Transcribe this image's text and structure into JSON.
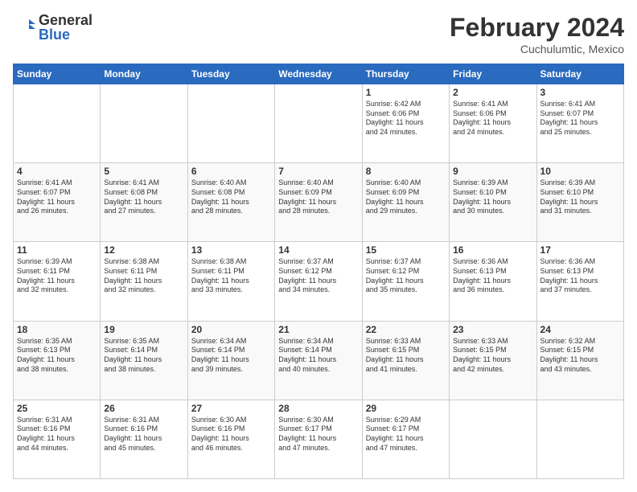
{
  "header": {
    "logo_general": "General",
    "logo_blue": "Blue",
    "cal_title": "February 2024",
    "cal_subtitle": "Cuchulumtic, Mexico"
  },
  "days_of_week": [
    "Sunday",
    "Monday",
    "Tuesday",
    "Wednesday",
    "Thursday",
    "Friday",
    "Saturday"
  ],
  "weeks": [
    [
      {
        "num": "",
        "info": ""
      },
      {
        "num": "",
        "info": ""
      },
      {
        "num": "",
        "info": ""
      },
      {
        "num": "",
        "info": ""
      },
      {
        "num": "1",
        "info": "Sunrise: 6:42 AM\nSunset: 6:06 PM\nDaylight: 11 hours\nand 24 minutes."
      },
      {
        "num": "2",
        "info": "Sunrise: 6:41 AM\nSunset: 6:06 PM\nDaylight: 11 hours\nand 24 minutes."
      },
      {
        "num": "3",
        "info": "Sunrise: 6:41 AM\nSunset: 6:07 PM\nDaylight: 11 hours\nand 25 minutes."
      }
    ],
    [
      {
        "num": "4",
        "info": "Sunrise: 6:41 AM\nSunset: 6:07 PM\nDaylight: 11 hours\nand 26 minutes."
      },
      {
        "num": "5",
        "info": "Sunrise: 6:41 AM\nSunset: 6:08 PM\nDaylight: 11 hours\nand 27 minutes."
      },
      {
        "num": "6",
        "info": "Sunrise: 6:40 AM\nSunset: 6:08 PM\nDaylight: 11 hours\nand 28 minutes."
      },
      {
        "num": "7",
        "info": "Sunrise: 6:40 AM\nSunset: 6:09 PM\nDaylight: 11 hours\nand 28 minutes."
      },
      {
        "num": "8",
        "info": "Sunrise: 6:40 AM\nSunset: 6:09 PM\nDaylight: 11 hours\nand 29 minutes."
      },
      {
        "num": "9",
        "info": "Sunrise: 6:39 AM\nSunset: 6:10 PM\nDaylight: 11 hours\nand 30 minutes."
      },
      {
        "num": "10",
        "info": "Sunrise: 6:39 AM\nSunset: 6:10 PM\nDaylight: 11 hours\nand 31 minutes."
      }
    ],
    [
      {
        "num": "11",
        "info": "Sunrise: 6:39 AM\nSunset: 6:11 PM\nDaylight: 11 hours\nand 32 minutes."
      },
      {
        "num": "12",
        "info": "Sunrise: 6:38 AM\nSunset: 6:11 PM\nDaylight: 11 hours\nand 32 minutes."
      },
      {
        "num": "13",
        "info": "Sunrise: 6:38 AM\nSunset: 6:11 PM\nDaylight: 11 hours\nand 33 minutes."
      },
      {
        "num": "14",
        "info": "Sunrise: 6:37 AM\nSunset: 6:12 PM\nDaylight: 11 hours\nand 34 minutes."
      },
      {
        "num": "15",
        "info": "Sunrise: 6:37 AM\nSunset: 6:12 PM\nDaylight: 11 hours\nand 35 minutes."
      },
      {
        "num": "16",
        "info": "Sunrise: 6:36 AM\nSunset: 6:13 PM\nDaylight: 11 hours\nand 36 minutes."
      },
      {
        "num": "17",
        "info": "Sunrise: 6:36 AM\nSunset: 6:13 PM\nDaylight: 11 hours\nand 37 minutes."
      }
    ],
    [
      {
        "num": "18",
        "info": "Sunrise: 6:35 AM\nSunset: 6:13 PM\nDaylight: 11 hours\nand 38 minutes."
      },
      {
        "num": "19",
        "info": "Sunrise: 6:35 AM\nSunset: 6:14 PM\nDaylight: 11 hours\nand 38 minutes."
      },
      {
        "num": "20",
        "info": "Sunrise: 6:34 AM\nSunset: 6:14 PM\nDaylight: 11 hours\nand 39 minutes."
      },
      {
        "num": "21",
        "info": "Sunrise: 6:34 AM\nSunset: 6:14 PM\nDaylight: 11 hours\nand 40 minutes."
      },
      {
        "num": "22",
        "info": "Sunrise: 6:33 AM\nSunset: 6:15 PM\nDaylight: 11 hours\nand 41 minutes."
      },
      {
        "num": "23",
        "info": "Sunrise: 6:33 AM\nSunset: 6:15 PM\nDaylight: 11 hours\nand 42 minutes."
      },
      {
        "num": "24",
        "info": "Sunrise: 6:32 AM\nSunset: 6:15 PM\nDaylight: 11 hours\nand 43 minutes."
      }
    ],
    [
      {
        "num": "25",
        "info": "Sunrise: 6:31 AM\nSunset: 6:16 PM\nDaylight: 11 hours\nand 44 minutes."
      },
      {
        "num": "26",
        "info": "Sunrise: 6:31 AM\nSunset: 6:16 PM\nDaylight: 11 hours\nand 45 minutes."
      },
      {
        "num": "27",
        "info": "Sunrise: 6:30 AM\nSunset: 6:16 PM\nDaylight: 11 hours\nand 46 minutes."
      },
      {
        "num": "28",
        "info": "Sunrise: 6:30 AM\nSunset: 6:17 PM\nDaylight: 11 hours\nand 47 minutes."
      },
      {
        "num": "29",
        "info": "Sunrise: 6:29 AM\nSunset: 6:17 PM\nDaylight: 11 hours\nand 47 minutes."
      },
      {
        "num": "",
        "info": ""
      },
      {
        "num": "",
        "info": ""
      }
    ]
  ]
}
